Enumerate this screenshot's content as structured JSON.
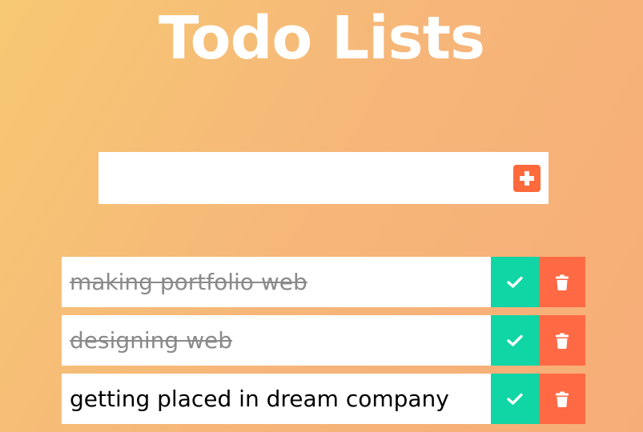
{
  "app": {
    "title": "Todo Lists"
  },
  "add_form": {
    "input_value": "",
    "input_placeholder": "",
    "add_icon": "plus-square-icon"
  },
  "todos": [
    {
      "text": "making portfolio web",
      "completed": true
    },
    {
      "text": "designing web",
      "completed": true
    },
    {
      "text": "getting placed in dream company",
      "completed": false
    }
  ],
  "icons": {
    "complete": "check-icon",
    "delete": "trash-icon"
  },
  "colors": {
    "background_start": "#f7c873",
    "background_end": "#f7ad78",
    "complete_button": "#0fd6a4",
    "delete_button": "#ff6a45",
    "add_button": "#ff6a3d",
    "completed_text": "#8a8a8a"
  }
}
